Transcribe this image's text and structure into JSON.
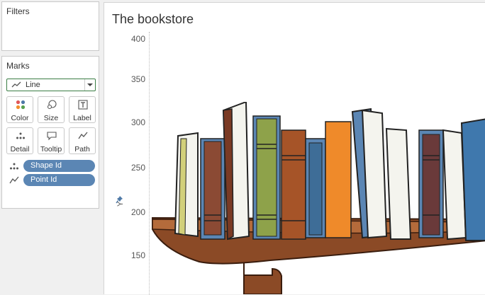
{
  "filters": {
    "title": "Filters"
  },
  "marks": {
    "title": "Marks",
    "mark_type": "Line",
    "buttons": [
      {
        "label": "Color",
        "icon": "color-dots-icon"
      },
      {
        "label": "Size",
        "icon": "size-circles-icon"
      },
      {
        "label": "Label",
        "icon": "label-text-icon"
      },
      {
        "label": "Detail",
        "icon": "detail-dots-icon"
      },
      {
        "label": "Tooltip",
        "icon": "tooltip-bubble-icon"
      },
      {
        "label": "Path",
        "icon": "path-line-icon"
      }
    ],
    "pills": [
      {
        "label": "Shape Id",
        "icon": "detail-dots-icon"
      },
      {
        "label": "Point Id",
        "icon": "path-line-icon"
      }
    ]
  },
  "view": {
    "title": "The bookstore",
    "y_axis_label": "Y",
    "ticks": [
      "400",
      "350",
      "300",
      "250",
      "200",
      "150"
    ]
  },
  "colors": {
    "pill": "#5b86b4",
    "select_border": "#3a7d44"
  }
}
